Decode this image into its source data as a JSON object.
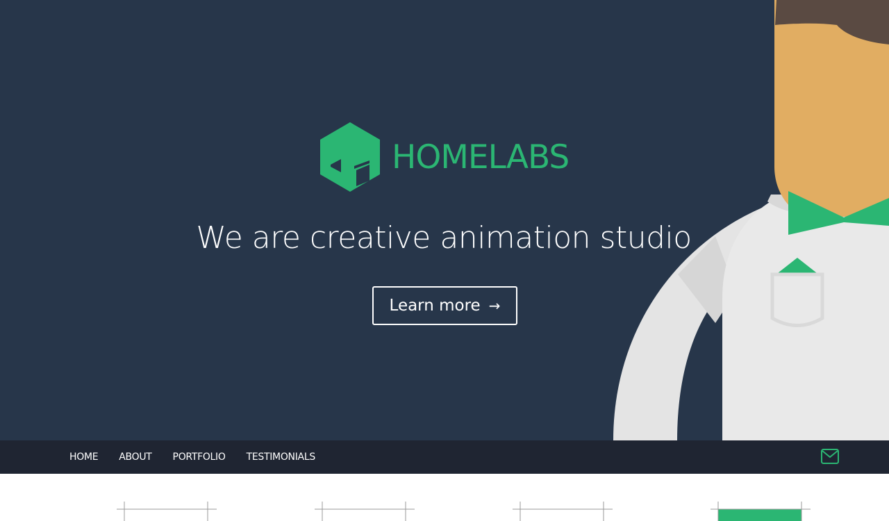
{
  "brand": {
    "name": "HOMELABS",
    "accent_color": "#2bb673",
    "logo_icon": "hexagon-house-icon"
  },
  "hero": {
    "tagline": "We are creative animation studio",
    "cta_label": "Learn more",
    "cta_icon": "arrow-right-icon",
    "background_color": "#27364a"
  },
  "nav": {
    "items": [
      "HOME",
      "ABOUT",
      "PORTFOLIO",
      "TESTIMONIALS"
    ],
    "contact_icon": "envelope-icon",
    "background_color": "#1f2532"
  }
}
